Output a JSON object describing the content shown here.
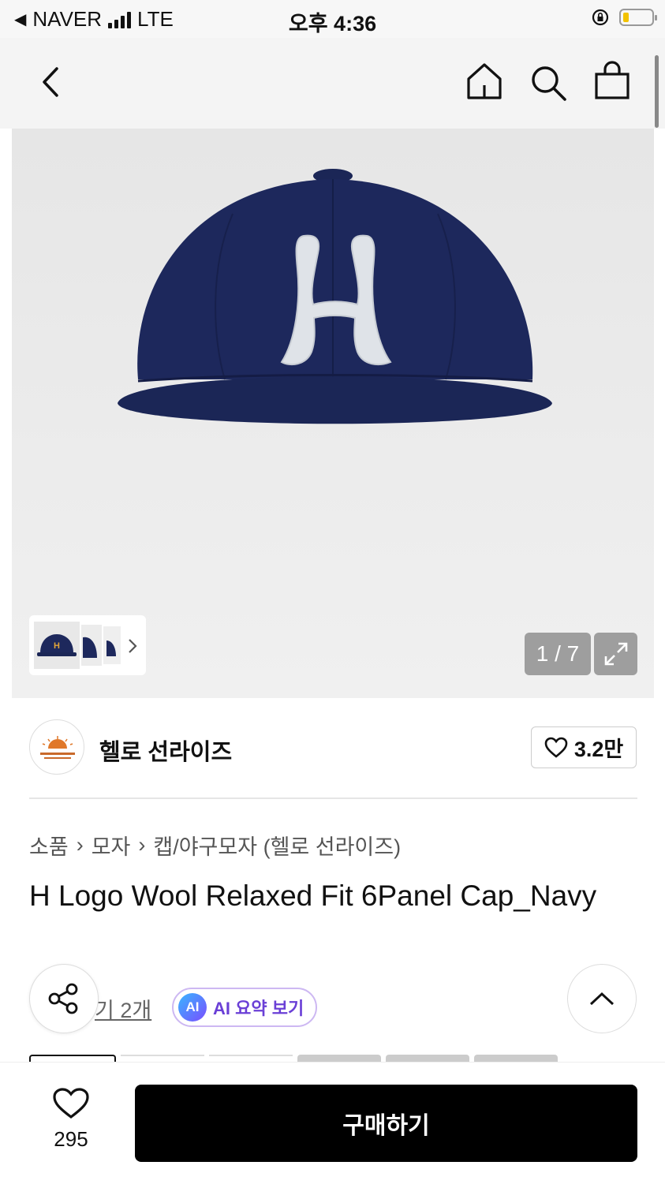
{
  "status_bar": {
    "back_app": "NAVER",
    "network": "LTE",
    "time": "오후 4:36",
    "battery_level": 0.15,
    "battery_color": "#f2c200"
  },
  "nav": {
    "icons": [
      "back-arrow-icon",
      "home-icon",
      "search-icon",
      "shopping-bag-icon"
    ]
  },
  "gallery": {
    "pager": "1 / 7",
    "product_letter": "H",
    "cap_color": "#1b2656",
    "thumb_letter": "H"
  },
  "brand": {
    "name": "헬로 선라이즈",
    "like_count": "3.2만"
  },
  "breadcrumb": [
    "소품",
    "모자",
    "캡/야구모자 (헬로 선라이즈)"
  ],
  "product": {
    "title": "H Logo Wool Relaxed Fit 6Panel Cap_Navy"
  },
  "review": {
    "text": "기 2개"
  },
  "ai_summary": {
    "badge": "AI",
    "label": "AI 요약 보기",
    "accent": "#6a3fd6"
  },
  "bottom_bar": {
    "wish_count": "295",
    "buy_label": "구매하기"
  }
}
